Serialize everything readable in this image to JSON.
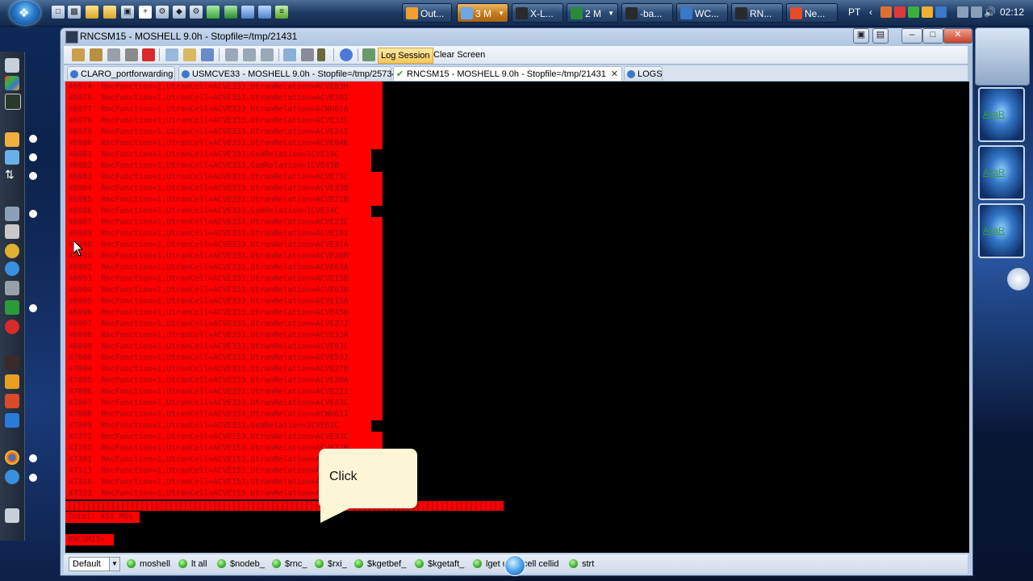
{
  "taskbar": {
    "buttons": [
      {
        "label": "Out...",
        "color": "#f0a030"
      },
      {
        "label": "3 M",
        "color": "#6aa8e8",
        "active": true
      },
      {
        "label": "X-L...",
        "color": "#2a2a2a"
      },
      {
        "label": "2 M",
        "color": "#2a8a3a"
      },
      {
        "label": "-ba...",
        "color": "#2a2a2a"
      },
      {
        "label": "WC...",
        "color": "#3a78c8"
      },
      {
        "label": "RN...",
        "color": "#2a2a2a"
      },
      {
        "label": "Ne...",
        "color": "#e84a2a"
      }
    ],
    "language": "PT",
    "clock": "02:12"
  },
  "window": {
    "title": "RNCSM15 - MOSHELL 9.0h - Stopfile=/tmp/21431",
    "toolbar": {
      "log_session": "Log Session",
      "clear_screen": "Clear Screen"
    },
    "tabs": [
      {
        "label": "CLARO_portforwarding"
      },
      {
        "label": "USMCVE33 - MOSHELL 9.0h - Stopfile=/tmp/25734"
      },
      {
        "label": "RNCSM15 - MOSHELL 9.0h - Stopfile=/tmp/21431",
        "active": true
      },
      {
        "label": "LOGS"
      }
    ]
  },
  "terminal": {
    "lines": [
      "46974  RncFunction=1,UtranCell=ACVE333,UtranRelation=ACVE83M",
      "46976  RncFunction=1,UtranCell=ACVE333,UtranRelation=ACVE201",
      "46977  RncFunction=1,UtranCell=ACVE333,UtranRelation=ACWK61A",
      "46978  RncFunction=1,UtranCell=ACVE333,UtranRelation=ACVE33C",
      "46979  RncFunction=1,UtranCell=ACVE333,UtranRelation=ACVE241",
      "46980  RncFunction=1,UtranCell=ACVE333,UtranRelation=ACVE84K",
      "46981  RncFunction=1,UtranCell=ACVE333,GsmRelation=1CVE19C",
      "46982  RncFunction=1,UtranCell=ACVE333,GsmRelation=1CVE45B",
      "46983  RncFunction=1,UtranCell=ACVE333,UtranRelation=ACVE73C",
      "46984  RncFunction=1,UtranCell=ACVE333,UtranRelation=ACVE33B",
      "46985  RncFunction=1,UtranCell=ACVE333,UtranRelation=ACVE21B",
      "46986  RncFunction=1,UtranCell=ACVE333,GsmRelation=1CVE34C",
      "46987  RncFunction=1,UtranCell=ACVE333,UtranRelation=ACVE23C",
      "46989  RncFunction=1,UtranCell=ACVE333,UtranRelation=ACVE191",
      "46990  RncFunction=1,UtranCell=ACVE333,UtranRelation=ACVE31A",
      "46991  RncFunction=1,UtranCell=ACVE333,UtranRelation=ACVE20M",
      "46992  RncFunction=1,UtranCell=ACVE333,UtranRelation=ACVE63A",
      "46993  RncFunction=1,UtranCell=ACVE333,UtranRelation=ACVE15B",
      "46994  RncFunction=1,UtranCell=ACVE333,UtranRelation=ACVE63B",
      "46995  RncFunction=1,UtranCell=ACVE333,UtranRelation=ACVE15A",
      "46996  RncFunction=1,UtranCell=ACVE333,UtranRelation=ACVE45B",
      "46997  RncFunction=1,UtranCell=ACVE333,UtranRelation=ACVE27J",
      "46998  RncFunction=1,UtranCell=ACVE333,UtranRelation=ACVE33A",
      "46999  RncFunction=1,UtranCell=ACVE333,UtranRelation=ACVE63C",
      "47000  RncFunction=1,UtranCell=ACVE333,UtranRelation=ACVE53J",
      "47004  RncFunction=1,UtranCell=ACVE333,UtranRelation=ACVE27B",
      "47005  RncFunction=1,UtranCell=ACVE333,UtranRelation=ACVE20A",
      "47006  RncFunction=1,UtranCell=ACVE333,UtranRelation=ACVE221",
      "47007  RncFunction=1,UtranCell=ACVE333,UtranRelation=ACVE43C",
      "47008  RncFunction=1,UtranCell=ACVE333,UtranRelation=ACWK61J",
      "47009  RncFunction=1,UtranCell=ACVE333,GsmRelation=1CVE63C",
      "47271  RncFunction=1,UtranCell=ACVE153,UtranRelation=ACVE33C",
      "47281  RncFunction=1,UtranCell=ACVE153,UtranRelation=ACVE27B",
      "47301  RncFunction=1,UtranCell=ACVE153,UtranRelation=ACVE20A",
      "47313  RncFunction=1,UtranCell=ACVE153,UtranRelation=ACVE43C",
      "47316  RncFunction=1,UtranCell=ACVE153,UtranRelation=ACVE27J",
      "47323  RncFunction=1,UtranCell=ACVE153,UtranRelation=ACVE33A"
    ],
    "short_rows": [
      6,
      7,
      11,
      30
    ],
    "total": "Total: 451 MOs",
    "prompt": "RNCSM15>"
  },
  "callout": {
    "text": "Click"
  },
  "commandbar": {
    "preset": "Default",
    "commands": [
      "moshell",
      "lt all",
      "$nodeb_",
      "$rnc_",
      "$rxi_",
      "$kgetbef_",
      "$kgetaft_",
      "lget utrancell cellid",
      "strt"
    ]
  },
  "gadgets": [
    "AltaR",
    "AltaR",
    "AltaR"
  ]
}
